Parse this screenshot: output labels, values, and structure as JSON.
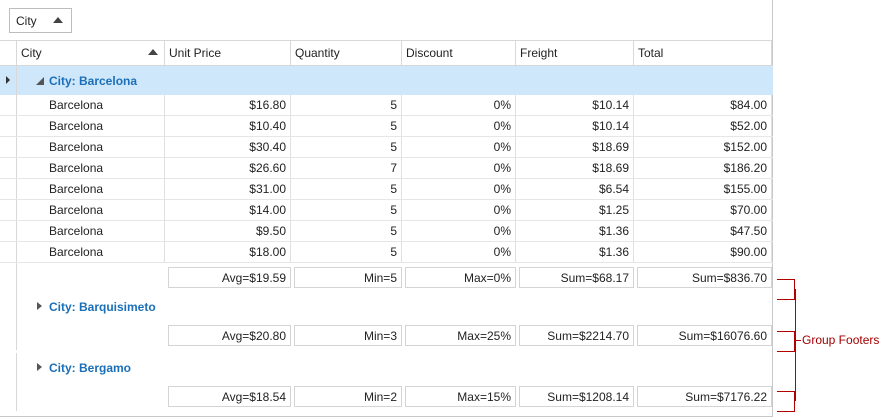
{
  "group_panel": {
    "chip_label": "City"
  },
  "columns": [
    "City",
    "Unit Price",
    "Quantity",
    "Discount",
    "Freight",
    "Total"
  ],
  "groups": [
    {
      "title": "City: Barcelona",
      "expanded": true,
      "rows": [
        [
          "Barcelona",
          "$16.80",
          "5",
          "0%",
          "$10.14",
          "$84.00"
        ],
        [
          "Barcelona",
          "$10.40",
          "5",
          "0%",
          "$10.14",
          "$52.00"
        ],
        [
          "Barcelona",
          "$30.40",
          "5",
          "0%",
          "$18.69",
          "$152.00"
        ],
        [
          "Barcelona",
          "$26.60",
          "7",
          "0%",
          "$18.69",
          "$186.20"
        ],
        [
          "Barcelona",
          "$31.00",
          "5",
          "0%",
          "$6.54",
          "$155.00"
        ],
        [
          "Barcelona",
          "$14.00",
          "5",
          "0%",
          "$1.25",
          "$70.00"
        ],
        [
          "Barcelona",
          "$9.50",
          "5",
          "0%",
          "$1.36",
          "$47.50"
        ],
        [
          "Barcelona",
          "$18.00",
          "5",
          "0%",
          "$1.36",
          "$90.00"
        ]
      ],
      "footer": [
        "Avg=$19.59",
        "Min=5",
        "Max=0%",
        "Sum=$68.17",
        "Sum=$836.70"
      ]
    },
    {
      "title": "City: Barquisimeto",
      "expanded": false,
      "rows": [],
      "footer": [
        "Avg=$20.80",
        "Min=3",
        "Max=25%",
        "Sum=$2214.70",
        "Sum=$16076.60"
      ]
    },
    {
      "title": "City: Bergamo",
      "expanded": false,
      "rows": [],
      "footer": [
        "Avg=$18.54",
        "Min=2",
        "Max=15%",
        "Sum=$1208.14",
        "Sum=$7176.22"
      ]
    }
  ],
  "annotation": {
    "label": "Group Footers",
    "color": "#b00000"
  },
  "colors": {
    "group_title": "#1a6fb8",
    "selected_group_bg": "#cfe7fa"
  }
}
